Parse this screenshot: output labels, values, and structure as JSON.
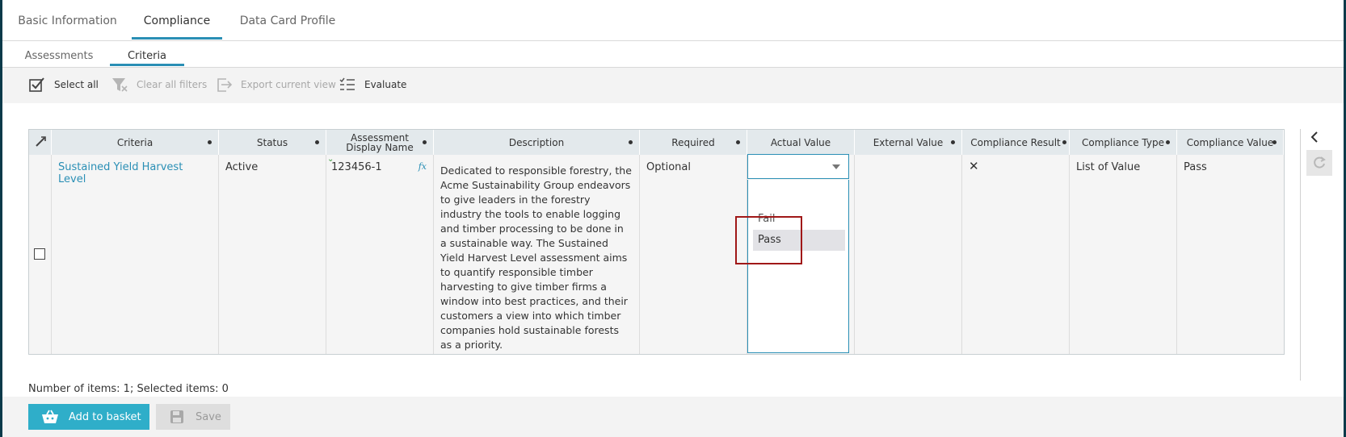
{
  "tabs": [
    {
      "label": "Basic Information"
    },
    {
      "label": "Compliance"
    },
    {
      "label": "Data Card Profile"
    }
  ],
  "subtabs": [
    {
      "label": "Assessments"
    },
    {
      "label": "Criteria"
    }
  ],
  "toolbar": {
    "select_all": "Select all",
    "clear_filters": "Clear all filters",
    "export_view": "Export current view",
    "evaluate": "Evaluate"
  },
  "grid": {
    "headers": {
      "criteria": "Criteria",
      "status": "Status",
      "assessment_line1": "Assessment",
      "assessment_line2": "Display Name",
      "description": "Description",
      "required": "Required",
      "actual_value": "Actual Value",
      "external_value": "External Value",
      "compliance_result": "Compliance Result",
      "compliance_type": "Compliance Type",
      "compliance_value": "Compliance Value"
    },
    "row": {
      "criteria": "Sustained Yield Harvest Level",
      "status": "Active",
      "assessment": "123456-1",
      "fx": "fx",
      "description": "Dedicated to responsible forestry, the Acme Sustainability Group endeavors to give leaders in the forestry industry the tools to enable logging and timber processing to be done in a sustainable way. The Sustained Yield Harvest Level assessment aims to quantify responsible timber harvesting to give timber firms a window into best practices, and their customers a view into which timber companies hold sustainable forests as a priority.",
      "required": "Optional",
      "actual_value": "",
      "external_value": "",
      "compliance_result": "✕",
      "compliance_type": "List of Value",
      "compliance_value": "Pass"
    },
    "dropdown_options": [
      {
        "label": "Fail"
      },
      {
        "label": "Pass"
      }
    ]
  },
  "status_text": "Number of items: 1; Selected items: 0",
  "footer": {
    "add_to_basket": "Add to basket",
    "save": "Save"
  },
  "colors": {
    "accent": "#2a8fb5",
    "primary_button": "#2faec9",
    "highlight": "#a01818"
  }
}
